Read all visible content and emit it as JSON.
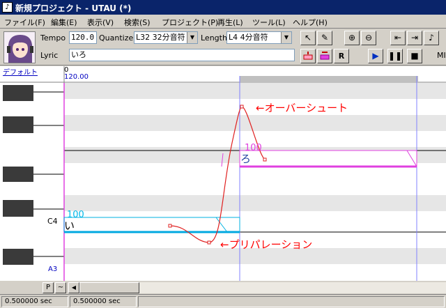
{
  "window": {
    "title": "新規プロジェクト - UTAU (*)"
  },
  "menu": [
    "ファイル(F)",
    "編集(E)",
    "表示(V)",
    "検索(S)",
    "プロジェクト(P)",
    "再生(L)",
    "ツール(L)",
    "ヘルプ(H)"
  ],
  "toolbar": {
    "tempo_label": "Tempo",
    "tempo_value": "120.0",
    "quantize_label": "Quantize",
    "quantize_value": "L32 32分音符",
    "length_label": "Length",
    "length_value": "L4  4分音符",
    "lyric_label": "Lyric",
    "lyric_value": "いろ",
    "midi_label": "MI"
  },
  "track": {
    "name": "デフォルト"
  },
  "ruler": {
    "measure": "0",
    "tempo": "120.00"
  },
  "piano": {
    "c4_label": "C4",
    "a3_label": "A3"
  },
  "notes": [
    {
      "lyric": "い",
      "intensity": "100"
    },
    {
      "lyric": "ろ",
      "intensity": "100"
    }
  ],
  "annotations": {
    "overshoot": "←オーバーシュート",
    "preparation": "←プリパレーション"
  },
  "scrollbar": {
    "p_button": "P",
    "tilde_button": "~"
  },
  "status": {
    "left": "0.500000 sec",
    "right": "0.500000 sec"
  },
  "colors": {
    "titlebar": "#0a246a",
    "pitch_curve": "#e02020",
    "note_a": "#00b0e0",
    "note_b": "#e040e0",
    "grid_line": "#8080ff"
  }
}
